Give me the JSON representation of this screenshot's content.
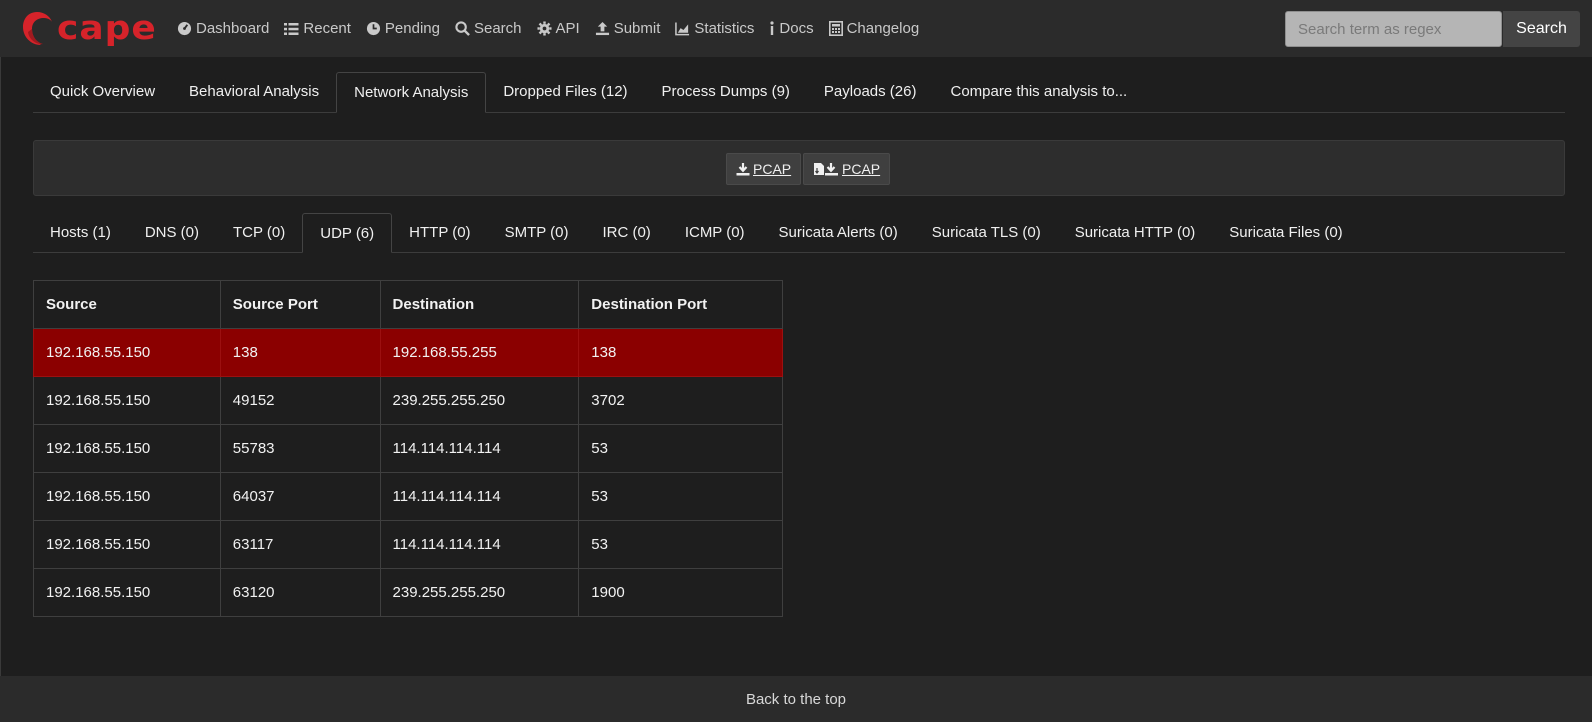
{
  "brand": {
    "name": "cape",
    "color": "#d6232a"
  },
  "nav": {
    "items": [
      {
        "label": "Dashboard",
        "icon": "dashboard-icon"
      },
      {
        "label": "Recent",
        "icon": "list-icon"
      },
      {
        "label": "Pending",
        "icon": "clock-icon"
      },
      {
        "label": "Search",
        "icon": "search-icon"
      },
      {
        "label": "API",
        "icon": "gear-icon"
      },
      {
        "label": "Submit",
        "icon": "upload-icon"
      },
      {
        "label": "Statistics",
        "icon": "chart-icon"
      },
      {
        "label": "Docs",
        "icon": "info-icon"
      },
      {
        "label": "Changelog",
        "icon": "calculator-icon"
      }
    ],
    "search_placeholder": "Search term as regex",
    "search_button": "Search"
  },
  "main_tabs": [
    {
      "label": "Quick Overview",
      "active": false
    },
    {
      "label": "Behavioral Analysis",
      "active": false
    },
    {
      "label": "Network Analysis",
      "active": true
    },
    {
      "label": "Dropped Files (12)",
      "active": false
    },
    {
      "label": "Process Dumps (9)",
      "active": false
    },
    {
      "label": "Payloads (26)",
      "active": false
    },
    {
      "label": "Compare this analysis to...",
      "active": false
    }
  ],
  "pcap": {
    "download_label": "PCAP",
    "download_alt_label": "PCAP"
  },
  "sub_tabs": [
    {
      "label": "Hosts (1)",
      "active": false
    },
    {
      "label": "DNS (0)",
      "active": false
    },
    {
      "label": "TCP (0)",
      "active": false
    },
    {
      "label": "UDP (6)",
      "active": true
    },
    {
      "label": "HTTP (0)",
      "active": false
    },
    {
      "label": "SMTP (0)",
      "active": false
    },
    {
      "label": "IRC (0)",
      "active": false
    },
    {
      "label": "ICMP (0)",
      "active": false
    },
    {
      "label": "Suricata Alerts (0)",
      "active": false
    },
    {
      "label": "Suricata TLS (0)",
      "active": false
    },
    {
      "label": "Suricata HTTP (0)",
      "active": false
    },
    {
      "label": "Suricata Files (0)",
      "active": false
    }
  ],
  "udp_table": {
    "headers": [
      "Source",
      "Source Port",
      "Destination",
      "Destination Port"
    ],
    "rows": [
      {
        "cells": [
          "192.168.55.150",
          "138",
          "192.168.55.255",
          "138"
        ],
        "highlight": true
      },
      {
        "cells": [
          "192.168.55.150",
          "49152",
          "239.255.255.250",
          "3702"
        ],
        "highlight": false
      },
      {
        "cells": [
          "192.168.55.150",
          "55783",
          "114.114.114.114",
          "53"
        ],
        "highlight": false
      },
      {
        "cells": [
          "192.168.55.150",
          "64037",
          "114.114.114.114",
          "53"
        ],
        "highlight": false
      },
      {
        "cells": [
          "192.168.55.150",
          "63117",
          "114.114.114.114",
          "53"
        ],
        "highlight": false
      },
      {
        "cells": [
          "192.168.55.150",
          "63120",
          "239.255.255.250",
          "1900"
        ],
        "highlight": false
      }
    ],
    "highlight_color": "#8b0000"
  },
  "footer": {
    "back_to_top": "Back to the top"
  }
}
